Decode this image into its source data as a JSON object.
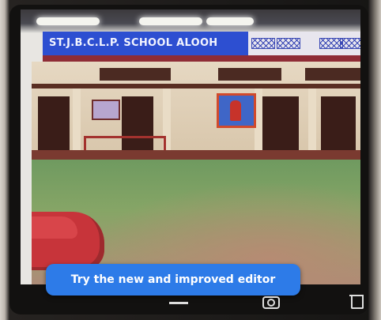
{
  "photo": {
    "sign_text": "ST.J.B.C.L.P. SCHOOL ALOOH",
    "colors": {
      "sign": "#2d4fd1",
      "roof_trim": "#8f2c36",
      "lawn": "#86a566",
      "plinth": "#c7343a"
    }
  },
  "banner": {
    "label": "Try the new and improved editor",
    "color": "#2d7be8"
  },
  "toolbar": {
    "icons": [
      "crop-icon",
      "lens-icon",
      "trash-icon"
    ]
  }
}
